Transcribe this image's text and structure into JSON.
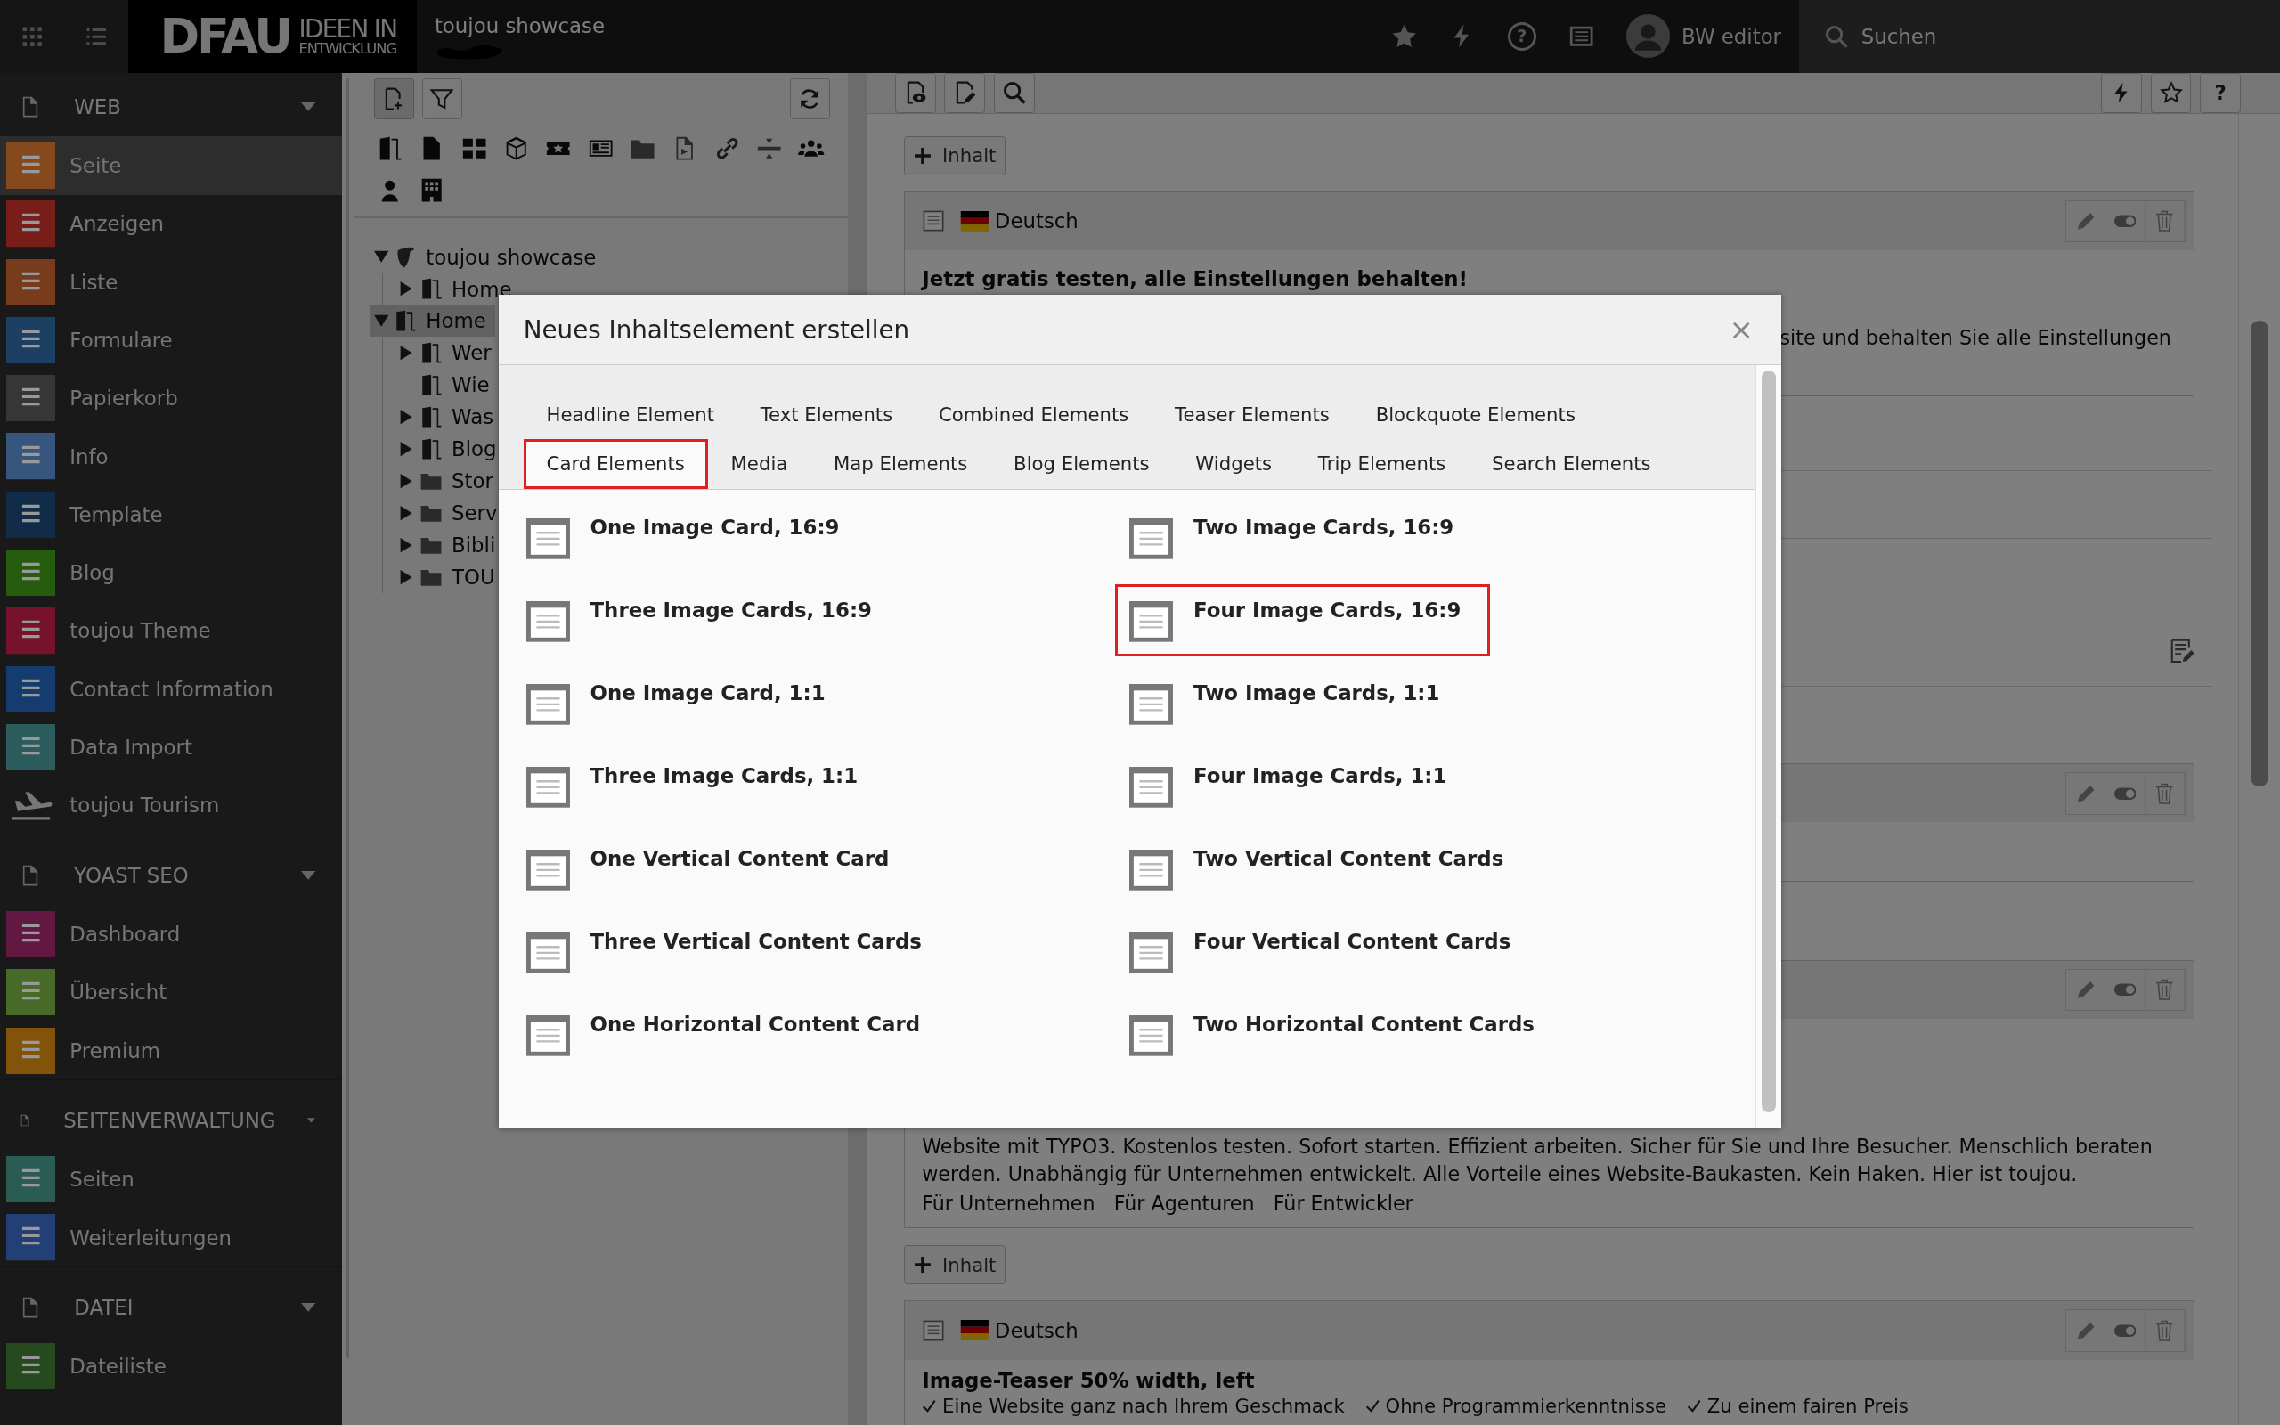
{
  "topbar": {
    "logo": {
      "wordmark": "DFAU",
      "tagline_1": "IDEEN IN",
      "tagline_2": "ENTWICKLUNG"
    },
    "site_name": "toujou showcase",
    "help_glyph": "?",
    "user": "BW editor",
    "search": {
      "placeholder": "Suchen"
    }
  },
  "sidebar": {
    "groups": [
      {
        "title": "WEB",
        "expanded": true,
        "items": [
          {
            "label": "Seite",
            "color": "#86491d",
            "selected": true
          },
          {
            "label": "Anzeigen",
            "color": "#781d1a",
            "selected": false
          },
          {
            "label": "Liste",
            "color": "#783c1c",
            "selected": false
          },
          {
            "label": "Formulare",
            "color": "#1c4064",
            "selected": false
          },
          {
            "label": "Papierkorb",
            "color": "#363636",
            "selected": false
          },
          {
            "label": "Info",
            "color": "#37567d",
            "selected": false
          },
          {
            "label": "Template",
            "color": "#112c49",
            "selected": false
          },
          {
            "label": "Blog",
            "color": "#255c0e",
            "selected": false
          },
          {
            "label": "toujou Theme",
            "color": "#76122b",
            "selected": false
          },
          {
            "label": "Contact Information",
            "color": "#153c6e",
            "selected": false
          },
          {
            "label": "Data Import",
            "color": "#2c5c5b",
            "selected": false
          },
          {
            "label": "toujou Tourism",
            "selected": false
          }
        ]
      },
      {
        "title": "YOAST SEO",
        "expanded": true,
        "items": [
          {
            "label": "Dashboard",
            "color": "#621840",
            "selected": false
          },
          {
            "label": "Übersicht",
            "color": "#476a28",
            "selected": false
          },
          {
            "label": "Premium",
            "color": "#82530b",
            "selected": false
          }
        ]
      },
      {
        "title": "SEITENVERWALTUNG",
        "expanded": true,
        "items": [
          {
            "label": "Seiten",
            "color": "#2a5c54",
            "selected": false
          },
          {
            "label": "Weiterleitungen",
            "color": "#233f76",
            "selected": false
          }
        ]
      },
      {
        "title": "DATEI",
        "expanded": true,
        "items": [
          {
            "label": "Dateiliste",
            "color": "#26491e",
            "selected": false
          }
        ]
      }
    ]
  },
  "page_tree": {
    "nodes": [
      {
        "label": "toujou showcase",
        "kind": "site",
        "collapsible": true,
        "expanded": true,
        "selected": false,
        "children": [
          {
            "label": "Home",
            "kind": "page",
            "collapsible": true,
            "expanded": false,
            "selected": false
          }
        ]
      },
      {
        "label": "Home",
        "kind": "page",
        "collapsible": true,
        "expanded": true,
        "selected": true,
        "children": [
          {
            "label": "Wer",
            "kind": "page",
            "collapsible": true,
            "expanded": false,
            "selected": false
          },
          {
            "label": "Wie",
            "kind": "page",
            "collapsible": false,
            "selected": false
          },
          {
            "label": "Was",
            "kind": "page",
            "collapsible": true,
            "expanded": false,
            "selected": false
          },
          {
            "label": "Blog",
            "kind": "page",
            "collapsible": true,
            "expanded": false,
            "selected": false
          },
          {
            "label": "Stor",
            "kind": "folder",
            "collapsible": true,
            "expanded": false,
            "selected": false
          },
          {
            "label": "Serv",
            "kind": "folder",
            "collapsible": true,
            "expanded": false,
            "selected": false
          },
          {
            "label": "Bibli",
            "kind": "folder",
            "collapsible": true,
            "expanded": false,
            "selected": false
          },
          {
            "label": "TOU",
            "kind": "folder",
            "collapsible": true,
            "expanded": false,
            "selected": false
          }
        ]
      }
    ]
  },
  "docheader": {
    "help_label": "?"
  },
  "content": {
    "add_button_1": "Inhalt",
    "card_1": {
      "language": "Deutsch",
      "heading": "Jetzt gratis testen, alle Einstellungen behalten!",
      "text": "site und behalten Sie alle Einstellungen"
    },
    "card_3": {
      "text": "Website mit TYPO3. Kostenlos testen. Sofort starten. Effizient arbeiten. Sicher für Sie und Ihre Besucher. Menschlich beraten werden. Unabhängig für Unternehmen entwickelt. Alle Vorteile eines Website-Baukasten. Kein Haken. Hier ist toujou.",
      "links": [
        "Für Unternehmen",
        "Für Agenturen",
        "Für Entwickler"
      ]
    },
    "add_button_2": "Inhalt",
    "card_4": {
      "language": "Deutsch",
      "heading": "Image-Teaser 50% width, left",
      "features": [
        "Eine Website ganz nach Ihrem Geschmack",
        "Ohne Programmierkenntnisse",
        "Zu einem fairen Preis"
      ]
    }
  },
  "modal": {
    "title": "Neues Inhaltselement erstellen",
    "close": "×",
    "tabs": [
      {
        "label": "Headline Element",
        "selected": false,
        "highlighted": false
      },
      {
        "label": "Text Elements",
        "selected": false,
        "highlighted": false
      },
      {
        "label": "Combined Elements",
        "selected": false,
        "highlighted": false
      },
      {
        "label": "Teaser Elements",
        "selected": false,
        "highlighted": false
      },
      {
        "label": "Blockquote Elements",
        "selected": false,
        "highlighted": false
      },
      {
        "label": "Card Elements",
        "selected": true,
        "highlighted": true
      },
      {
        "label": "Media",
        "selected": false,
        "highlighted": false
      },
      {
        "label": "Map Elements",
        "selected": false,
        "highlighted": false
      },
      {
        "label": "Blog Elements",
        "selected": false,
        "highlighted": false
      },
      {
        "label": "Widgets",
        "selected": false,
        "highlighted": false
      },
      {
        "label": "Trip Elements",
        "selected": false,
        "highlighted": false
      },
      {
        "label": "Search Elements",
        "selected": false,
        "highlighted": false
      }
    ],
    "items": [
      {
        "label": "One Image Card, 16:9",
        "highlighted": false
      },
      {
        "label": "Two Image Cards, 16:9",
        "highlighted": false
      },
      {
        "label": "Three Image Cards, 16:9",
        "highlighted": false
      },
      {
        "label": "Four Image Cards, 16:9",
        "highlighted": true
      },
      {
        "label": "One Image Card, 1:1",
        "highlighted": false
      },
      {
        "label": "Two Image Cards, 1:1",
        "highlighted": false
      },
      {
        "label": "Three Image Cards, 1:1",
        "highlighted": false
      },
      {
        "label": "Four Image Cards, 1:1",
        "highlighted": false
      },
      {
        "label": "One Vertical Content Card",
        "highlighted": false
      },
      {
        "label": "Two Vertical Content Cards",
        "highlighted": false
      },
      {
        "label": "Three Vertical Content Cards",
        "highlighted": false
      },
      {
        "label": "Four Vertical Content Cards",
        "highlighted": false
      },
      {
        "label": "One Horizontal Content Card",
        "highlighted": false
      },
      {
        "label": "Two Horizontal Content Cards",
        "highlighted": false
      }
    ]
  }
}
